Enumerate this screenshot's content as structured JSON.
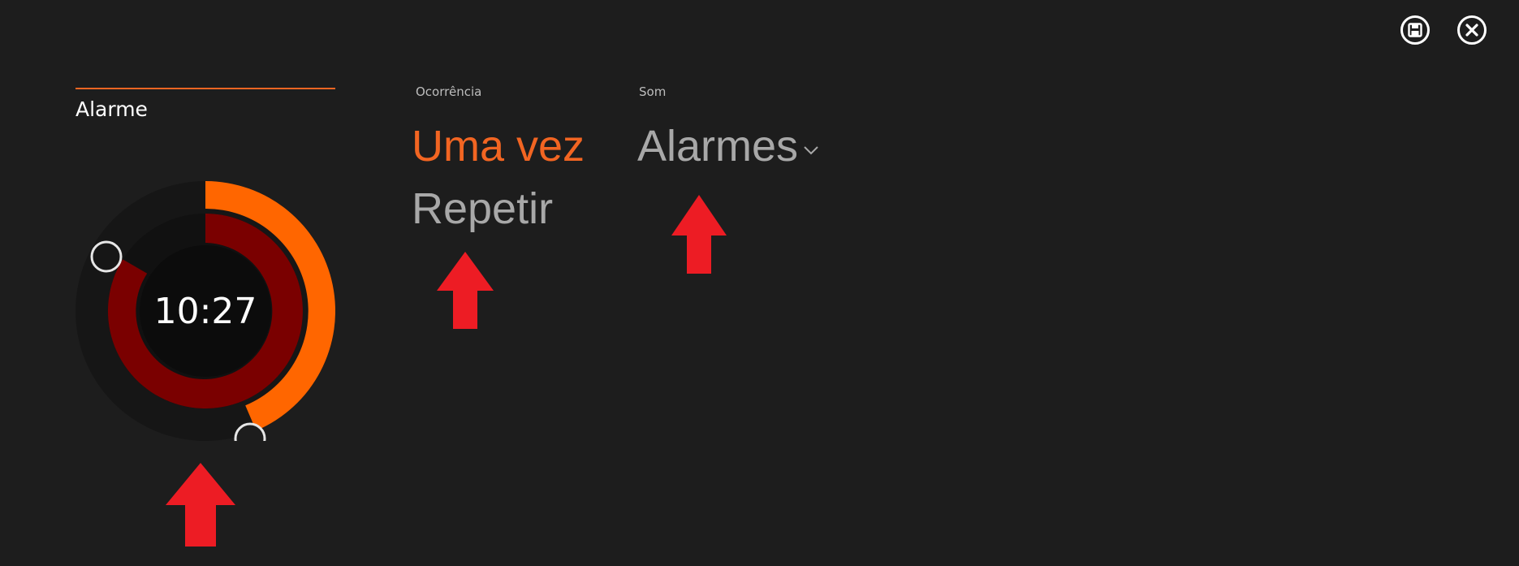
{
  "toolbar": {
    "save_icon": "save-icon",
    "close_icon": "close-icon"
  },
  "alarm_tab": {
    "label": "Alarme",
    "accent_color": "#f26522"
  },
  "time_dial": {
    "time": "10:27",
    "hour_ring_color": "#ff6600",
    "minute_ring_color": "#7a0000",
    "center_color": "#0c0c0c"
  },
  "occurrence": {
    "label": "Ocorrência",
    "options": [
      {
        "label": "Uma vez",
        "selected": true
      },
      {
        "label": "Repetir",
        "selected": false
      }
    ]
  },
  "sound": {
    "label": "Som",
    "selected": "Alarmes",
    "chevron_icon": "chevron-down-icon"
  },
  "annotations": {
    "arrow_color": "#ed1c24",
    "arrow_icon": "arrow-up-icon"
  }
}
